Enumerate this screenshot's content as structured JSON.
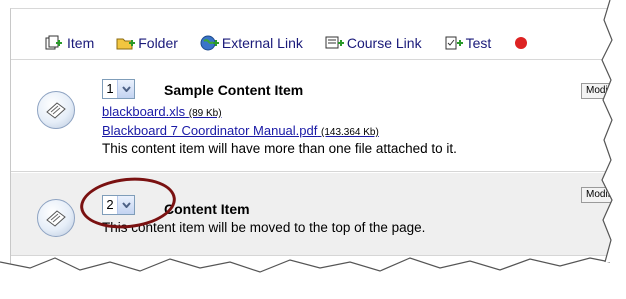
{
  "toolbar": {
    "items": [
      {
        "label": "Item",
        "icon": "add-item-icon"
      },
      {
        "label": "Folder",
        "icon": "add-folder-icon"
      },
      {
        "label": "External Link",
        "icon": "add-external-link-icon"
      },
      {
        "label": "Course Link",
        "icon": "add-course-link-icon"
      },
      {
        "label": "Test",
        "icon": "add-test-icon"
      }
    ]
  },
  "content_items": [
    {
      "order": "1",
      "title": "Sample Content Item",
      "attachments": [
        {
          "name": "blackboard.xls",
          "size": "(89 Kb)"
        },
        {
          "name": "Blackboard 7 Coordinator Manual.pdf",
          "size": "(143.364 Kb)"
        }
      ],
      "description": "This content item will have more than one file attached to it.",
      "modify_label": "Modi"
    },
    {
      "order": "2",
      "title": "Content Item",
      "description": "This content item will be moved to the top of the page.",
      "modify_label": "Modify"
    }
  ],
  "colors": {
    "link": "#1a1aa6",
    "highlight": "#7a1111",
    "row_alt": "#efefef"
  }
}
